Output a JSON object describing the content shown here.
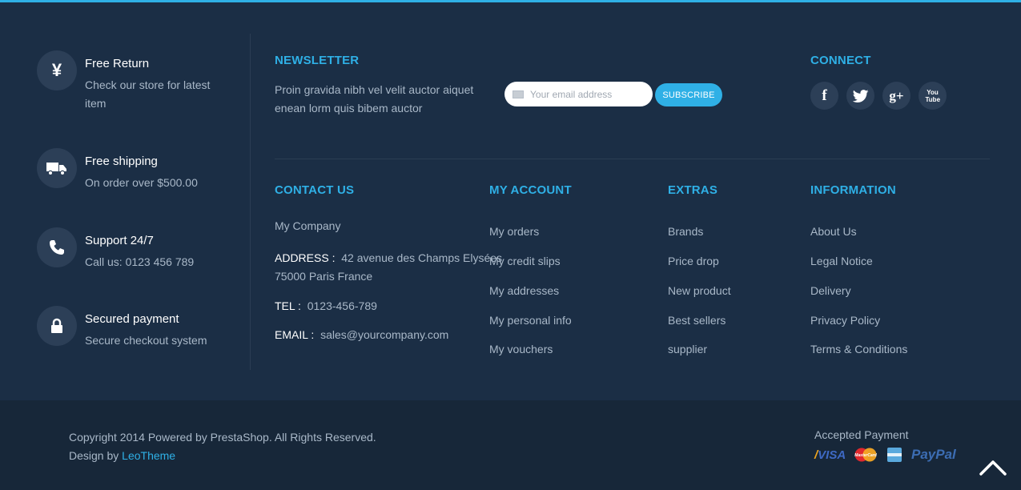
{
  "services": [
    {
      "icon": "yen-icon",
      "glyph": "¥",
      "title": "Free Return",
      "desc": "Check our store for latest item"
    },
    {
      "icon": "truck-icon",
      "title": "Free shipping",
      "desc": "On order over $500.00"
    },
    {
      "icon": "phone-icon",
      "title": "Support 24/7",
      "desc": "Call us: 0123 456 789"
    },
    {
      "icon": "lock-icon",
      "title": "Secured payment",
      "desc": "Secure checkout system"
    }
  ],
  "newsletter": {
    "heading": "NEWSLETTER",
    "text": "Proin gravida nibh vel velit auctor aiquet enean lorm quis bibem auctor",
    "placeholder": "Your email address",
    "button": "SUBSCRIBE"
  },
  "connect": {
    "heading": "CONNECT",
    "icons": [
      "facebook-icon",
      "twitter-icon",
      "google-plus-icon",
      "youtube-icon"
    ],
    "facebook_glyph": "f",
    "google_glyph": "g+",
    "youtube_glyph": "You Tube"
  },
  "contact": {
    "heading": "CONTACT US",
    "company": "My Company",
    "address_label": "ADDRESS :",
    "address_value": "42 avenue des Champs Elysées",
    "address_line2": "75000 Paris France",
    "tel_label": "TEL :",
    "tel_value": "0123-456-789",
    "email_label": "EMAIL :",
    "email_value": "sales@yourcompany.com"
  },
  "my_account": {
    "heading": "MY ACCOUNT",
    "items": [
      "My orders",
      "My credit slips",
      "My addresses",
      "My personal info",
      "My vouchers"
    ]
  },
  "extras": {
    "heading": "EXTRAS",
    "items": [
      "Brands",
      "Price drop",
      "New product",
      "Best sellers",
      "supplier"
    ]
  },
  "information": {
    "heading": "INFORMATION",
    "items": [
      "About Us",
      "Legal Notice",
      "Delivery",
      "Privacy Policy",
      "Terms & Conditions"
    ]
  },
  "bottom": {
    "copyright": "Copyright 2014 Powered by PrestaShop. All Rights Reserved.",
    "design_by": "Design by",
    "designer": "LeoTheme",
    "payment_label": "Accepted Payment",
    "payments": [
      "VISA",
      "MasterCard",
      "American Express",
      "PayPal"
    ],
    "visa_text": "VISA",
    "paypal_text": "PayPal",
    "mastercard_text": "MasterCard"
  },
  "colors": {
    "accent": "#2fb0e6",
    "background": "#1b2e45",
    "bottom_background": "#172739"
  }
}
